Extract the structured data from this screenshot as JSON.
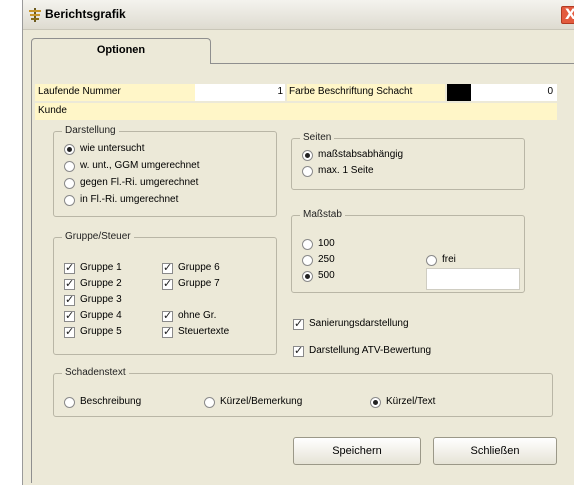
{
  "window": {
    "title": "Berichtsgrafik",
    "close_label": "X"
  },
  "tabs": [
    {
      "label": "Optionen",
      "active": true
    }
  ],
  "fields": {
    "laufende_nummer": {
      "label": "Laufende Nummer",
      "value": "1"
    },
    "farbe": {
      "label": "Farbe Beschriftung Schacht",
      "value": "0",
      "swatch_color": "#000000"
    },
    "kunde": {
      "label": "Kunde",
      "value": ""
    }
  },
  "darstellung": {
    "title": "Darstellung",
    "options": [
      {
        "label": "wie untersucht",
        "checked": true
      },
      {
        "label": "w. unt., GGM umgerechnet",
        "checked": false
      },
      {
        "label": "gegen Fl.-Ri. umgerechnet",
        "checked": false
      },
      {
        "label": "in Fl.-Ri. umgerechnet",
        "checked": false
      }
    ]
  },
  "seiten": {
    "title": "Seiten",
    "options": [
      {
        "label": "maßstabsabhängig",
        "checked": true
      },
      {
        "label": "max. 1 Seite",
        "checked": false
      }
    ]
  },
  "massstab": {
    "title": "Maßstab",
    "options": [
      {
        "label": "100",
        "checked": false
      },
      {
        "label": "250",
        "checked": false
      },
      {
        "label": "500",
        "checked": true
      },
      {
        "label": "frei",
        "checked": false
      }
    ],
    "frei_value": ""
  },
  "gruppe": {
    "title": "Gruppe/Steuer",
    "col1": [
      {
        "label": "Gruppe 1",
        "checked": true
      },
      {
        "label": "Gruppe 2",
        "checked": true
      },
      {
        "label": "Gruppe 3",
        "checked": true
      },
      {
        "label": "Gruppe 4",
        "checked": true
      },
      {
        "label": "Gruppe 5",
        "checked": true
      }
    ],
    "col2": [
      {
        "label": "Gruppe 6",
        "checked": true
      },
      {
        "label": "Gruppe 7",
        "checked": true
      },
      {
        "label": "ohne Gr.",
        "checked": true
      },
      {
        "label": "Steuertexte",
        "checked": true
      }
    ]
  },
  "extra": {
    "sanierung": {
      "label": "Sanierungsdarstellung",
      "checked": true
    },
    "atv": {
      "label": "Darstellung ATV-Bewertung",
      "checked": true
    }
  },
  "schadenstext": {
    "title": "Schadenstext",
    "options": [
      {
        "label": "Beschreibung",
        "checked": false
      },
      {
        "label": "Kürzel/Bemerkung",
        "checked": false
      },
      {
        "label": "Kürzel/Text",
        "checked": true
      }
    ]
  },
  "buttons": {
    "save": "Speichern",
    "close": "Schließen"
  }
}
